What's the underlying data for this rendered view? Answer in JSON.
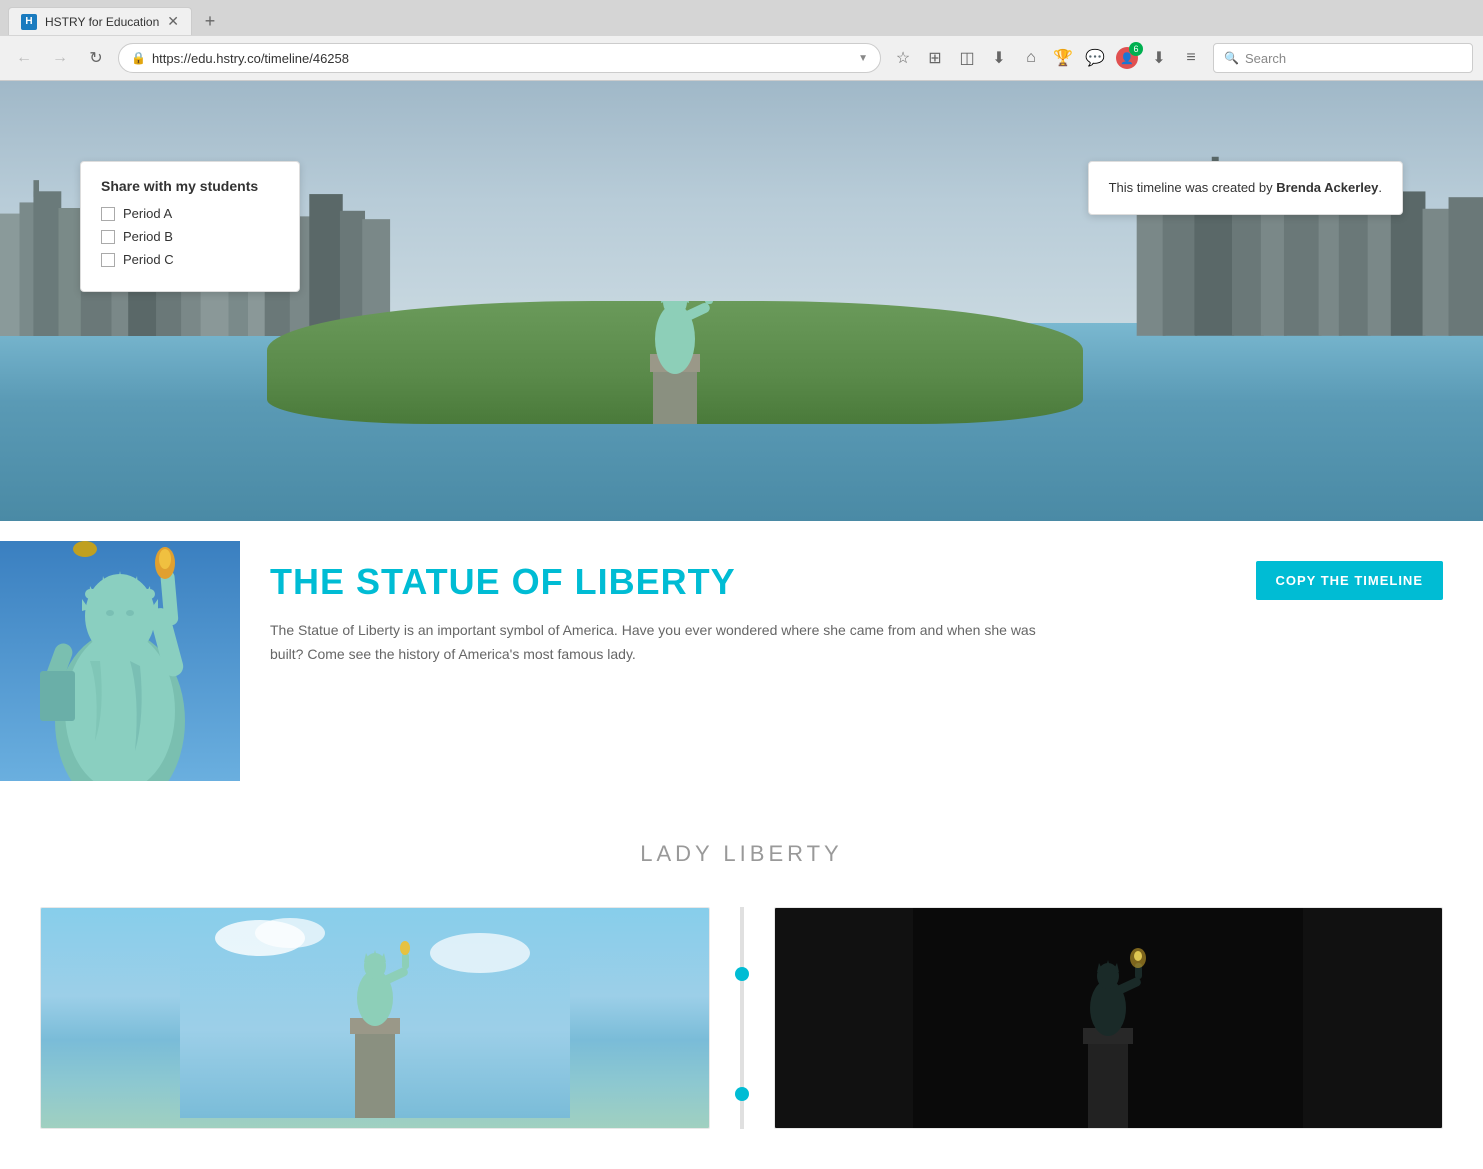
{
  "browser": {
    "tab_favicon": "H",
    "tab_title": "HSTRY for Education",
    "new_tab_label": "+",
    "url": "https://edu.hstry.co/timeline/46258",
    "search_placeholder": "Search"
  },
  "share_popup": {
    "title": "Share with my students",
    "options": [
      {
        "label": "Period A",
        "checked": false
      },
      {
        "label": "Period B",
        "checked": false
      },
      {
        "label": "Period C",
        "checked": false
      }
    ]
  },
  "creator_popup": {
    "text_prefix": "This timeline was created by ",
    "creator_name": "Brenda Ackerley",
    "text_suffix": "."
  },
  "timeline": {
    "title": "THE STATUE OF LIBERTY",
    "description": "The Statue of Liberty is an important symbol of America. Have you ever wondered where she came from and when she was built? Come see the history of America's most famous lady.",
    "copy_button_label": "COPY THE TIMELINE",
    "section_title": "LADY LIBERTY",
    "accent_color": "#00bcd4"
  }
}
